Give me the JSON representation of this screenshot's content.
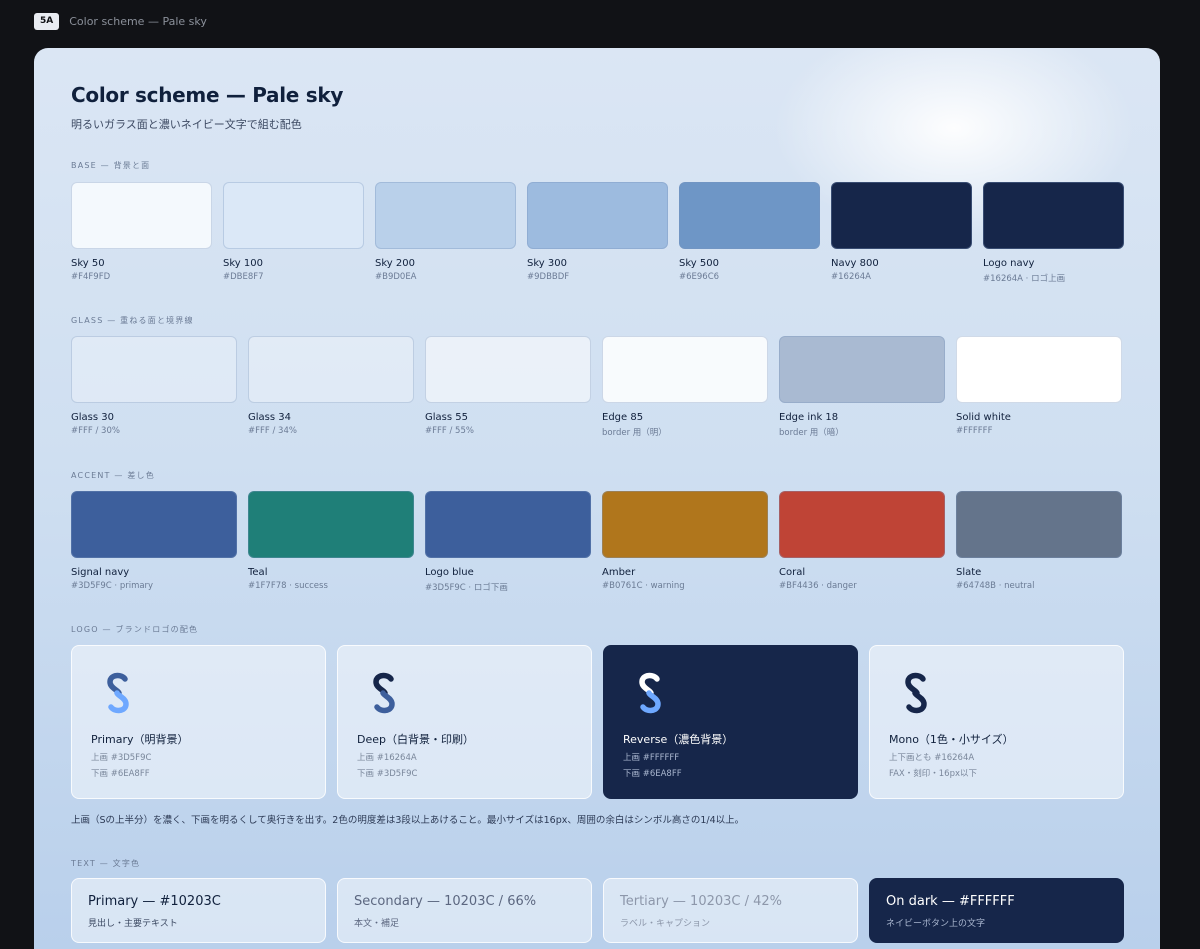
{
  "topbar": {
    "badge": "5A",
    "title": "Color scheme — Pale sky"
  },
  "header": {
    "title": "Color scheme — Pale sky",
    "subtitle": "明るいガラス面と濃いネイビー文字で組む配色"
  },
  "sections": {
    "base": "BASE — 背景と面",
    "glass": "GLASS — 重ねる面と境界線",
    "accent": "ACCENT — 差し色",
    "logo": "LOGO — ブランドロゴの配色",
    "text": "TEXT — 文字色"
  },
  "base": [
    {
      "name": "Sky 50",
      "code": "#F4F9FD",
      "color": "#F4F9FD"
    },
    {
      "name": "Sky 100",
      "code": "#DBE8F7",
      "color": "#DBE8F7"
    },
    {
      "name": "Sky 200",
      "code": "#B9D0EA",
      "color": "#B9D0EA"
    },
    {
      "name": "Sky 300",
      "code": "#9DBBDF",
      "color": "#9DBBDF"
    },
    {
      "name": "Sky 500",
      "code": "#6E96C6",
      "color": "#6E96C6"
    },
    {
      "name": "Navy 800",
      "code": "#16264A",
      "color": "#16264A"
    },
    {
      "name": "Logo navy",
      "code": "#16264A · ロゴ上画",
      "color": "#16264A"
    }
  ],
  "glass": [
    {
      "name": "Glass 30",
      "code": "#FFF / 30%",
      "color": "rgba(255,255,255,0.30)"
    },
    {
      "name": "Glass 34",
      "code": "#FFF / 34%",
      "color": "rgba(255,255,255,0.34)"
    },
    {
      "name": "Glass 55",
      "code": "#FFF / 55%",
      "color": "rgba(255,255,255,0.55)"
    },
    {
      "name": "Edge 85",
      "code": "border 用（明）",
      "color": "rgba(255,255,255,0.85)"
    },
    {
      "name": "Edge ink 18",
      "code": "border 用（暗）",
      "color": "#A9BAD2"
    },
    {
      "name": "Solid white",
      "code": "#FFFFFF",
      "color": "#FFFFFF"
    }
  ],
  "accent": [
    {
      "name": "Signal navy",
      "code": "#3D5F9C · primary",
      "color": "#3D5F9C"
    },
    {
      "name": "Teal",
      "code": "#1F7F78 · success",
      "color": "#1F7F78"
    },
    {
      "name": "Logo blue",
      "code": "#3D5F9C · ロゴ下画",
      "color": "#3D5F9C"
    },
    {
      "name": "Amber",
      "code": "#B0761C · warning",
      "color": "#B0761C"
    },
    {
      "name": "Coral",
      "code": "#BF4436 · danger",
      "color": "#BF4436"
    },
    {
      "name": "Slate",
      "code": "#64748B · neutral",
      "color": "#64748B"
    }
  ],
  "logos": [
    {
      "title": "Primary（明背景）",
      "line1": "上画 #3D5F9C",
      "line2": "下画 #6EA8FF",
      "top": "#3D5F9C",
      "bottom": "#6EA8FF"
    },
    {
      "title": "Deep（白背景・印刷）",
      "line1": "上画 #16264A",
      "line2": "下画 #3D5F9C",
      "top": "#16264A",
      "bottom": "#3D5F9C"
    },
    {
      "title": "Reverse（濃色背景）",
      "line1": "上画 #FFFFFF",
      "line2": "下画 #6EA8FF",
      "top": "#FFFFFF",
      "bottom": "#6EA8FF"
    },
    {
      "title": "Mono（1色・小サイズ）",
      "line1": "上下画とも #16264A",
      "line2": "FAX・刻印・16px以下",
      "top": "#16264A",
      "bottom": "#16264A"
    }
  ],
  "logo_note": "上画（Sの上半分）を濃く、下画を明るくして奥行きを出す。2色の明度差は3段以上あけること。最小サイズは16px、周囲の余白はシンボル高さの1/4以上。",
  "text_colors": [
    {
      "title": "Primary — #10203C",
      "sub": "見出し・主要テキスト",
      "title_color": "#10203C",
      "sub_color": "#3d4a63"
    },
    {
      "title": "Secondary — 10203C / 66%",
      "sub": "本文・補足",
      "title_color": "#5c6780",
      "sub_color": "#5c6780"
    },
    {
      "title": "Tertiary — 10203C / 42%",
      "sub": "ラベル・キャプション",
      "title_color": "#8d97aa",
      "sub_color": "#8d97aa"
    },
    {
      "title": "On dark — #FFFFFF",
      "sub": "ネイビーボタン上の文字",
      "title_color": "#FFFFFF",
      "sub_color": "#a9b6cf"
    }
  ]
}
